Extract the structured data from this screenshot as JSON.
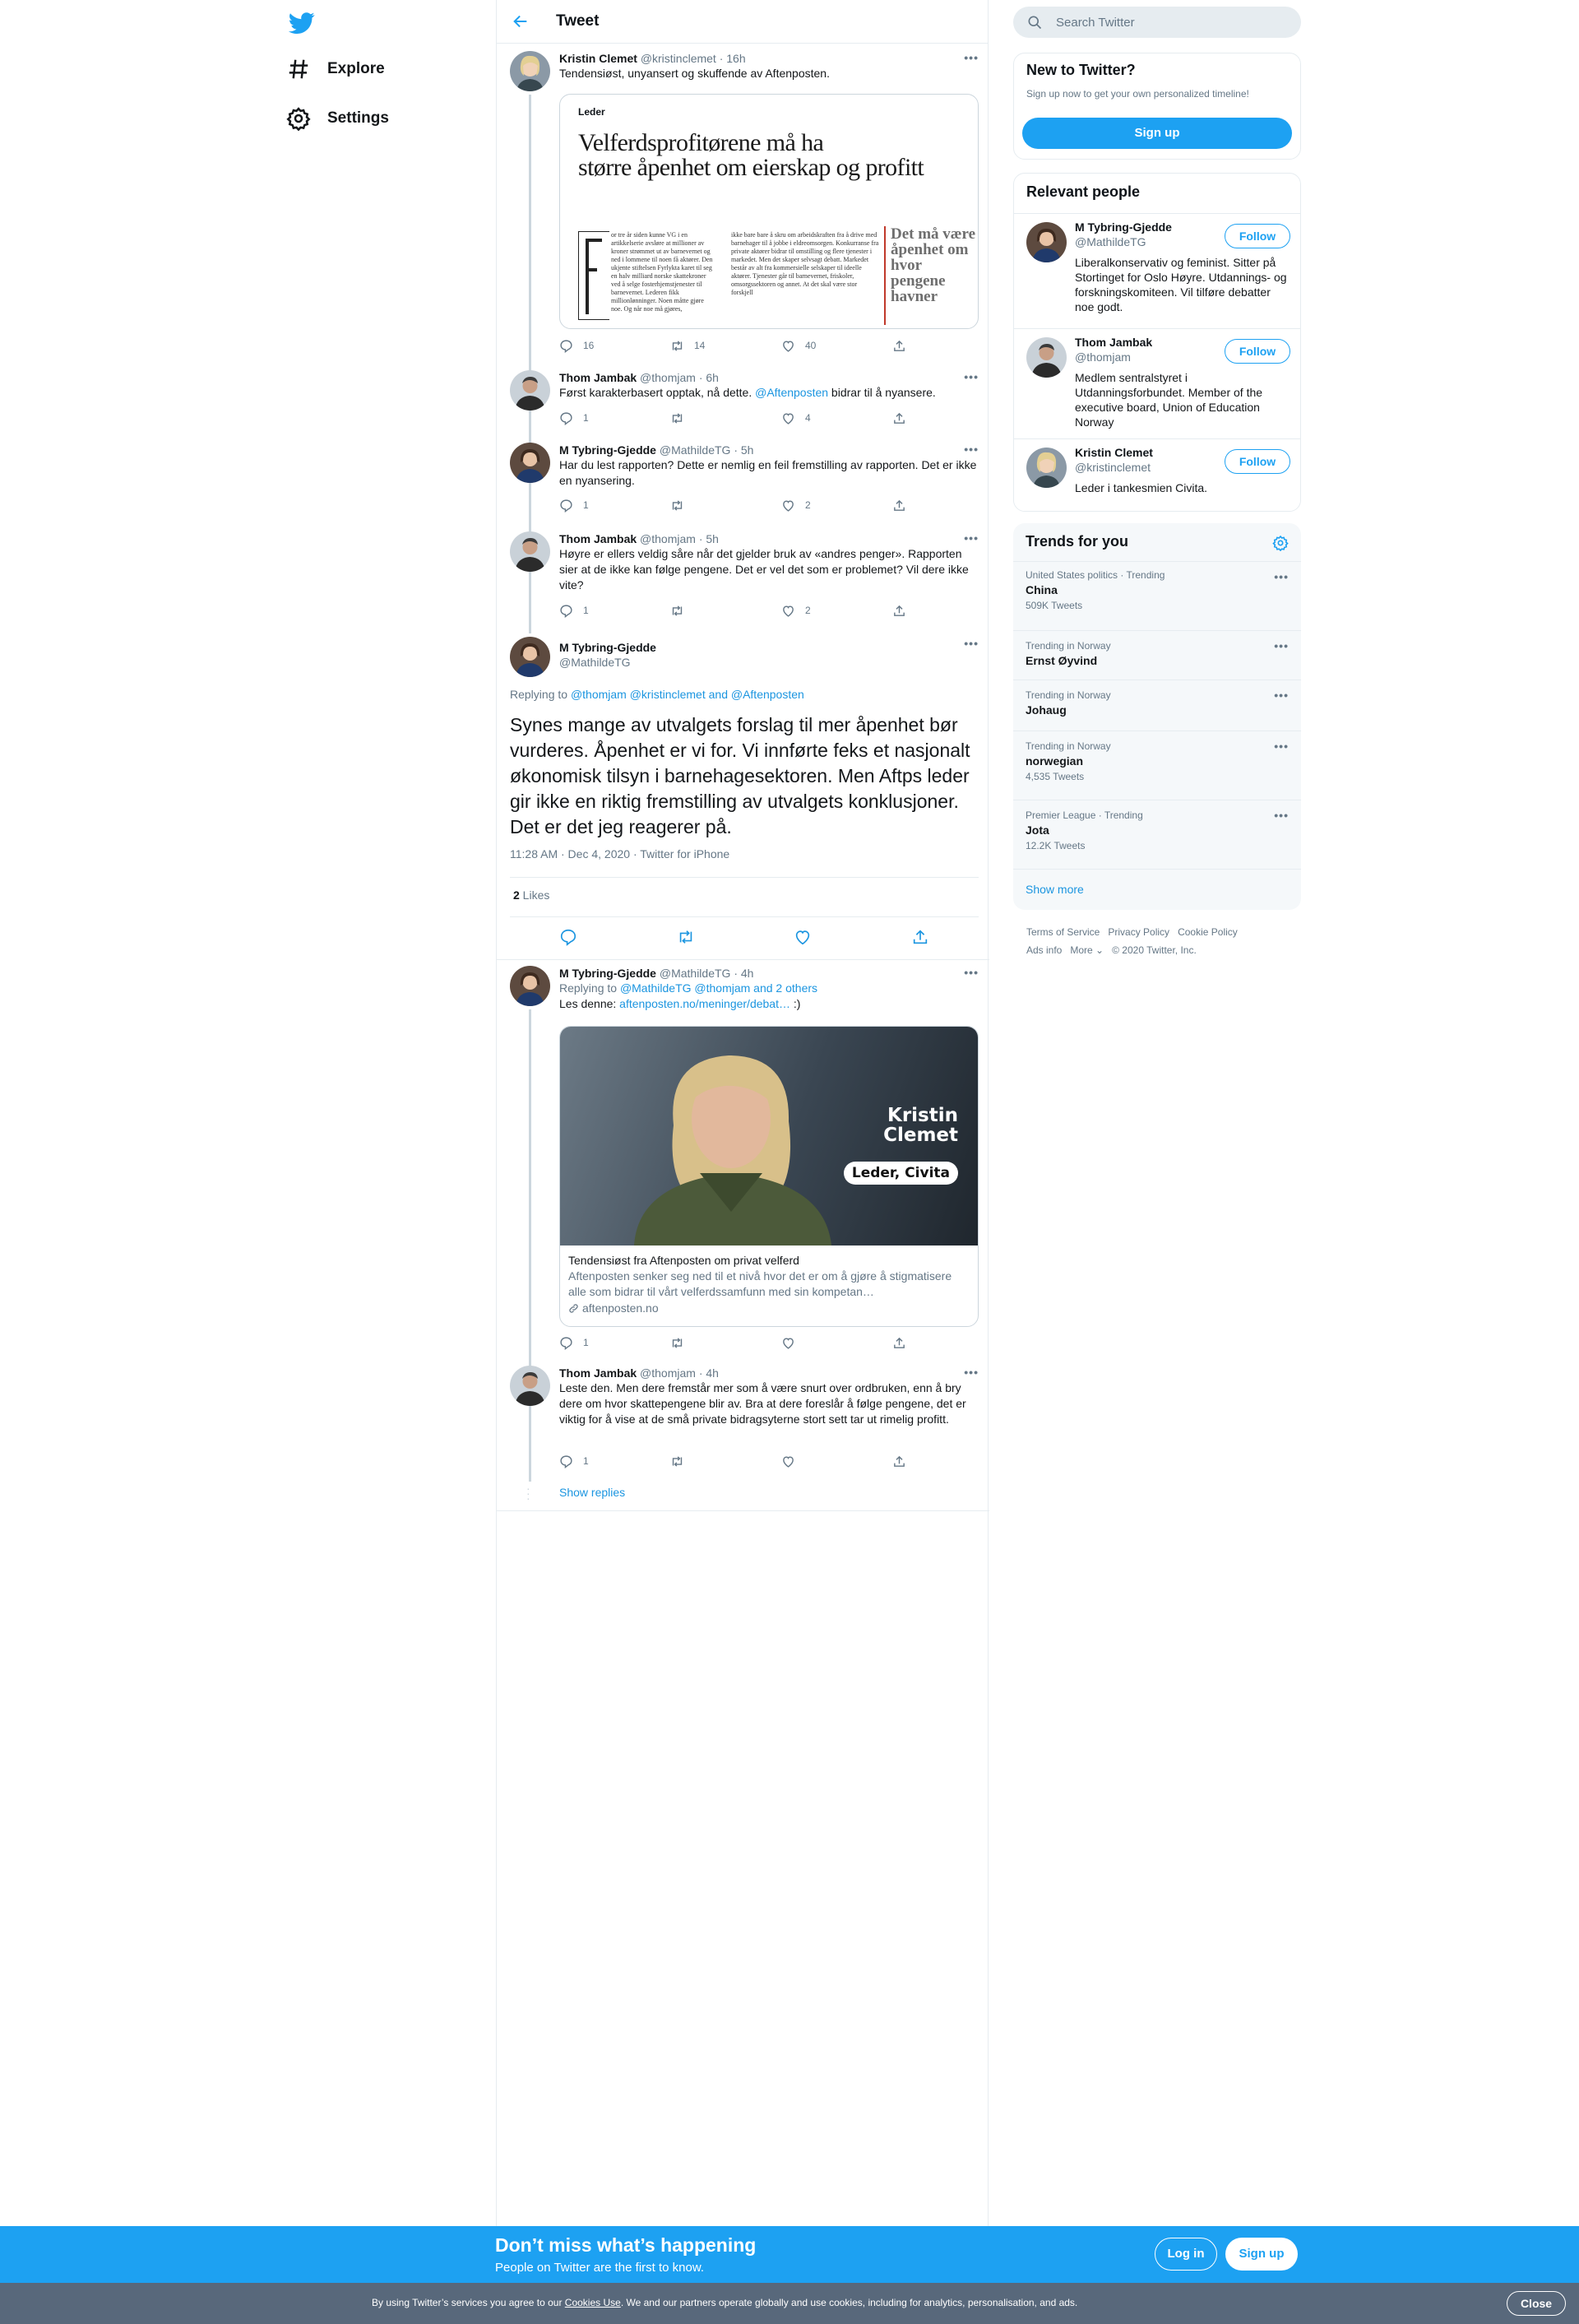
{
  "nav": {
    "explore_label": "Explore",
    "settings_label": "Settings"
  },
  "header": {
    "title": "Tweet"
  },
  "tweets": [
    {
      "name": "Kristin Clemet",
      "handle": "@kristinclemet",
      "time": "· 16h",
      "text": "Tendensiøst, unyansert og skuffende av Aftenposten.",
      "replies": "16",
      "retweets": "14",
      "likes": "40",
      "image": {
        "section": "Leder",
        "headline_line1": "Velferdsprofitørene må ha",
        "headline_line2": "større åpenhet om eierskap og profitt",
        "pullquote": "Det må være åpenhet om hvor pengene havner",
        "col1": "or tre år siden kunne VG i en artikkelserie avsløre at millioner av kroner strømmet ut av barnevernet og ned i lommene til noen få aktører. Den ukjente stiftelsen Fyrlykta karet til seg en halv milliard norske skattekroner ved å selge fosterhjemstjenester til barnevernet. Lederen fikk millionlønninger. Noen måtte gjøre noe. Og når noe må gjøres,",
        "col2": "ikke bare bare å skru om arbeidskraften fra å drive med barnehager til å jobbe i eldreomsorgen. Konkurranse fra private aktører bidrar til omstilling og flere tjenester i markedet. Men det skaper selvsagt debatt. Markedet består av alt fra kommersielle selskaper til ideelle aktører. Tjenester går til barnevernet, friskoler, omsorgssektoren og annet. At det skal være stor forskjell"
      }
    },
    {
      "name": "Thom Jambak",
      "handle": "@thomjam",
      "time": "· 6h",
      "text_before": "Først karakterbasert opptak, nå dette. ",
      "mention": "@Aftenposten",
      "text_after": " bidrar til å nyansere.",
      "replies": "1",
      "retweets": "",
      "likes": "4"
    },
    {
      "name": "M Tybring-Gjedde",
      "handle": "@MathildeTG",
      "time": "· 5h",
      "text": "Har du lest rapporten? Dette er nemlig en feil fremstilling av rapporten. Det er ikke en nyansering.",
      "replies": "1",
      "retweets": "",
      "likes": "2"
    },
    {
      "name": "Thom Jambak",
      "handle": "@thomjam",
      "time": "· 5h",
      "text": "Høyre er ellers veldig såre når det gjelder bruk av «andres penger». Rapporten sier at de ikke kan følge pengene. Det er vel det som er problemet? Vil dere ikke vite?",
      "replies": "1",
      "retweets": "",
      "likes": "2"
    }
  ],
  "focused": {
    "name": "M Tybring-Gjedde",
    "handle": "@MathildeTG",
    "replying_prefix": "Replying to ",
    "replying_to": "@thomjam @kristinclemet and @Aftenposten",
    "text": "Synes mange av utvalgets forslag til mer åpenhet bør vurderes. Åpenhet er vi for. Vi innførte feks et nasjonalt økonomisk tilsyn i barnehagesektoren. Men Aftps leder gir ikke en riktig fremstilling av utvalgets konklusjoner. Det er det jeg reagerer på.",
    "timestamp": "11:28 AM · Dec 4, 2020 · Twitter for iPhone",
    "likes_count": "2",
    "likes_label": " Likes"
  },
  "replies_after": [
    {
      "name": "M Tybring-Gjedde",
      "handle": "@MathildeTG",
      "time": "· 4h",
      "replying_prefix": "Replying to ",
      "replying_to": "@MathildeTG @thomjam and 2 others",
      "text_before": "Les denne: ",
      "link": "aftenposten.no/meninger/debat…",
      "text_after": " :)",
      "card": {
        "overlay_name_1": "Kristin",
        "overlay_name_2": "Clemet",
        "overlay_badge": "Leder, Civita",
        "title": "Tendensiøst fra Aftenposten om privat velferd",
        "description": "Aftenposten senker seg ned til et nivå hvor det er om å gjøre å stigmatisere alle som bidrar til vårt velferdssamfunn med sin kompetan…",
        "domain": "aftenposten.no"
      },
      "replies": "1"
    },
    {
      "name": "Thom Jambak",
      "handle": "@thomjam",
      "time": "· 4h",
      "text": "Leste den. Men dere fremstår mer som å være snurt over ordbruken, enn å bry dere om hvor skattepengene blir av. Bra at dere foreslår å følge pengene, det er viktig for å vise at de små private bidragsyterne stort sett tar ut rimelig profitt.",
      "replies": "1"
    }
  ],
  "show_replies": "Show replies",
  "sidebar": {
    "search_placeholder": "Search Twitter",
    "new_title": "New to Twitter?",
    "new_subtitle": "Sign up now to get your own personalized timeline!",
    "signup_label": "Sign up",
    "relevant_title": "Relevant people",
    "follow_label": "Follow",
    "people": [
      {
        "name": "M Tybring-Gjedde",
        "handle": "@MathildeTG",
        "bio": "Liberalkonservativ og feminist. Sitter på Stortinget for Oslo Høyre. Utdannings- og forskningskomiteen. Vil tilføre debatter noe godt."
      },
      {
        "name": "Thom Jambak",
        "handle": "@thomjam",
        "bio": "Medlem sentralstyret i Utdanningsforbundet. Member of the executive board, Union of Education Norway"
      },
      {
        "name": "Kristin Clemet",
        "handle": "@kristinclemet",
        "bio": "Leder i tankesmien Civita."
      }
    ],
    "trends_title": "Trends for you",
    "trends": [
      {
        "meta": "United States politics · Trending",
        "topic": "China",
        "count": "509K Tweets"
      },
      {
        "meta": "Trending in Norway",
        "topic": "Ernst Øyvind",
        "count": ""
      },
      {
        "meta": "Trending in Norway",
        "topic": "Johaug",
        "count": ""
      },
      {
        "meta": "Trending in Norway",
        "topic": "norwegian",
        "count": "4,535 Tweets"
      },
      {
        "meta": "Premier League · Trending",
        "topic": "Jota",
        "count": "12.2K Tweets"
      }
    ],
    "show_more": "Show more",
    "footer": {
      "terms": "Terms of Service",
      "privacy": "Privacy Policy",
      "cookie": "Cookie Policy",
      "ads": "Ads info",
      "more": "More ⌄",
      "copyright": "© 2020 Twitter, Inc."
    }
  },
  "bottom_bar": {
    "title": "Don’t miss what’s happening",
    "subtitle": "People on Twitter are the first to know.",
    "login_label": "Log in",
    "signup_label": "Sign up"
  },
  "cookie_bar": {
    "text_before": "By using Twitter’s services you agree to our ",
    "link": "Cookies Use",
    "text_after": ". We and our partners operate globally and use cookies, including for analytics, personalisation, and ads.",
    "close_label": "Close"
  },
  "colors": {
    "accent": "#1da1f2",
    "link": "#1b95e0",
    "cookie_bar": "#58687b"
  }
}
